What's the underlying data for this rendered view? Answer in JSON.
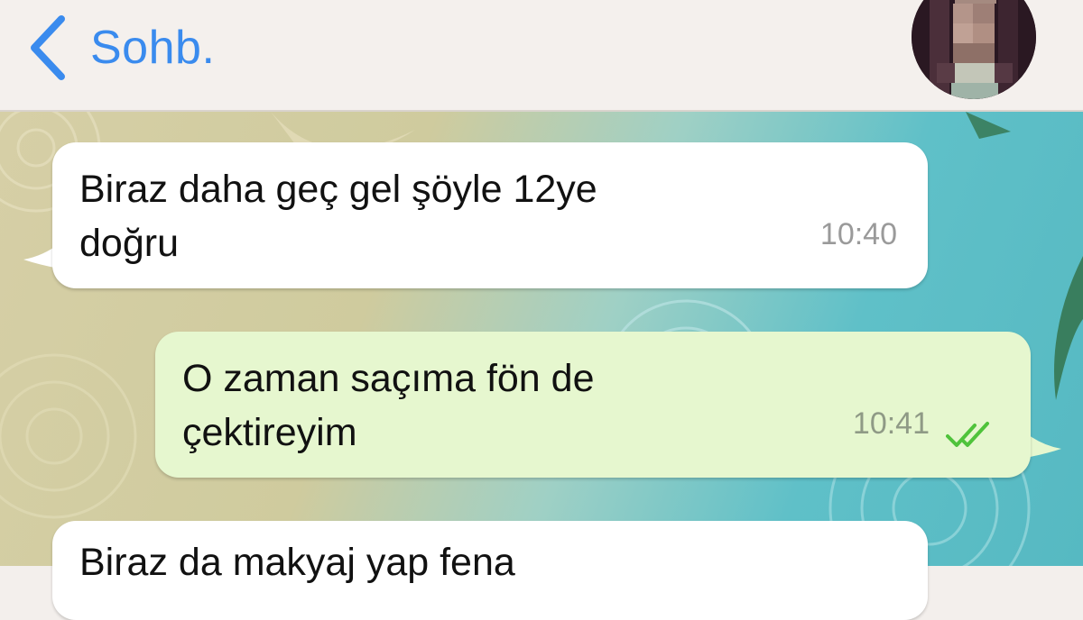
{
  "header": {
    "back_label": "Sohb.",
    "avatar": "blurred-contact-photo"
  },
  "messages": [
    {
      "direction": "incoming",
      "lines": [
        "Biraz daha geç gel şöyle 12ye",
        "doğru"
      ],
      "time": "10:40"
    },
    {
      "direction": "outgoing",
      "lines": [
        "O zaman saçıma fön de",
        "çektireyim"
      ],
      "time": "10:41",
      "status": "read"
    },
    {
      "direction": "incoming",
      "lines": [
        "Biraz da makyaj yap fena"
      ]
    }
  ],
  "colors": {
    "accent": "#3a8bee",
    "incoming_bubble": "#ffffff",
    "outgoing_bubble": "#e6f7cf",
    "read_ticks": "#4fc33b"
  }
}
